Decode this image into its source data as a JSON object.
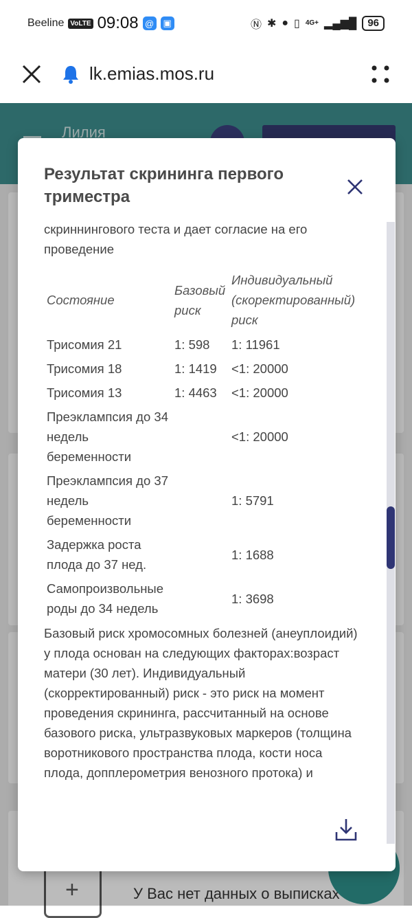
{
  "status_bar": {
    "carrier": "Beeline",
    "volte": "VoLTE",
    "time": "09:08",
    "network": "4G+",
    "battery": "96"
  },
  "browser": {
    "url": "lk.emias.mos.ru",
    "icons": {
      "close": "close-icon",
      "notifications": "bell-icon",
      "menu": "dots-menu-icon"
    }
  },
  "background": {
    "user_name": "Лилия",
    "empty_note": "У Вас нет данных о выписках",
    "header_color": "#3d8c8d"
  },
  "modal": {
    "title": "Результат скрининга первого триместра",
    "intro": "скриннингового теста и дает согласие на его проведение",
    "table": {
      "headers": [
        "Состояние",
        "Базовый риск",
        "Индивидуальный (скоректированный) риск"
      ],
      "rows": [
        {
          "condition": "Трисомия 21",
          "base": "1: 598",
          "individual": "1: 11961"
        },
        {
          "condition": "Трисомия 18",
          "base": "1: 1419",
          "individual": "<1: 20000"
        },
        {
          "condition": "Трисомия 13",
          "base": "1: 4463",
          "individual": "<1: 20000"
        },
        {
          "condition": "Преэклампсия до 34 недель беременности",
          "base": "",
          "individual": "<1: 20000"
        },
        {
          "condition": "Преэклампсия до 37 недель беременности",
          "base": "",
          "individual": "1: 5791"
        },
        {
          "condition": "Задержка роста плода до 37 нед.",
          "base": "",
          "individual": "1: 1688"
        },
        {
          "condition": "Самопроизвольные роды до 34 недель",
          "base": "",
          "individual": "1: 3698"
        }
      ]
    },
    "footer_text": "Базовый риск хромосомных болезней (анеуплоидий) у плода основан на следующих факторах:возраст матери (30 лет). Индивидуальный (скорректированный) риск - это риск на момент проведения скрининга, рассчитанный на основе базового риска, ультразвуковых маркеров (толщина воротникового пространства плода, кости носа плода, допплерометрия венозного протока) и",
    "scroll_position": 0.5,
    "accent_color": "#2f3574"
  }
}
